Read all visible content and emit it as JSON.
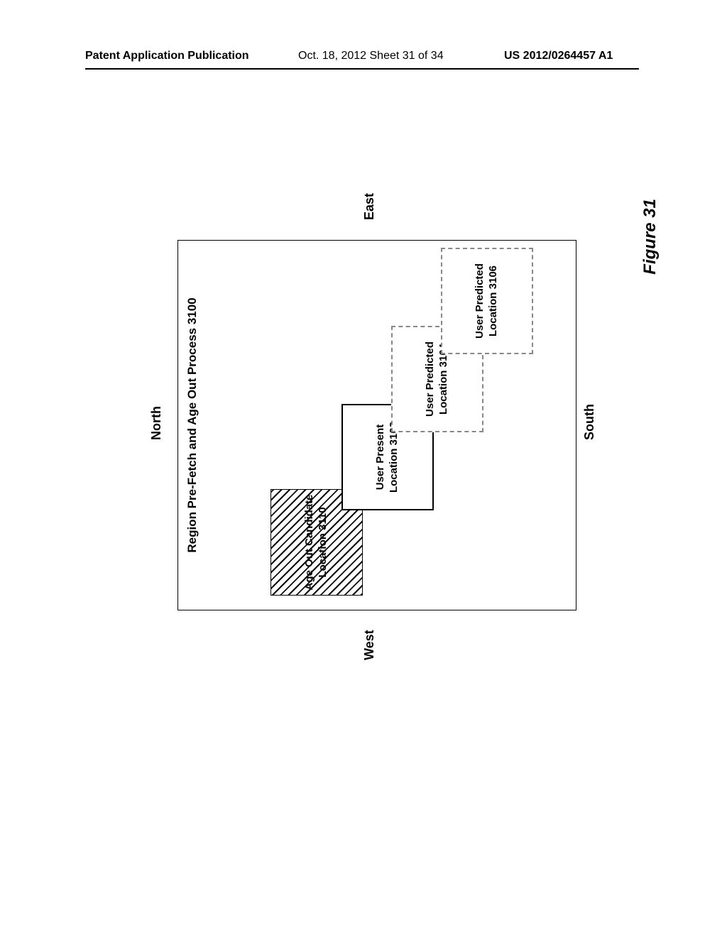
{
  "header": {
    "left": "Patent Application Publication",
    "mid": "Oct. 18, 2012  Sheet 31 of 34",
    "right": "US 2012/0264457 A1"
  },
  "compass": {
    "north": "North",
    "south": "South",
    "east": "East",
    "west": "West"
  },
  "region": {
    "title": "Region Pre-Fetch and Age\nOut Process 3100"
  },
  "boxes": {
    "ageout": "Age Out\nCandidate\nLocation 3110",
    "present": "User Present\nLocation 3102",
    "pred1": "User Predicted\nLocation 3104",
    "pred2": "User Predicted\nLocation 3106"
  },
  "figure_caption": "Figure 31"
}
